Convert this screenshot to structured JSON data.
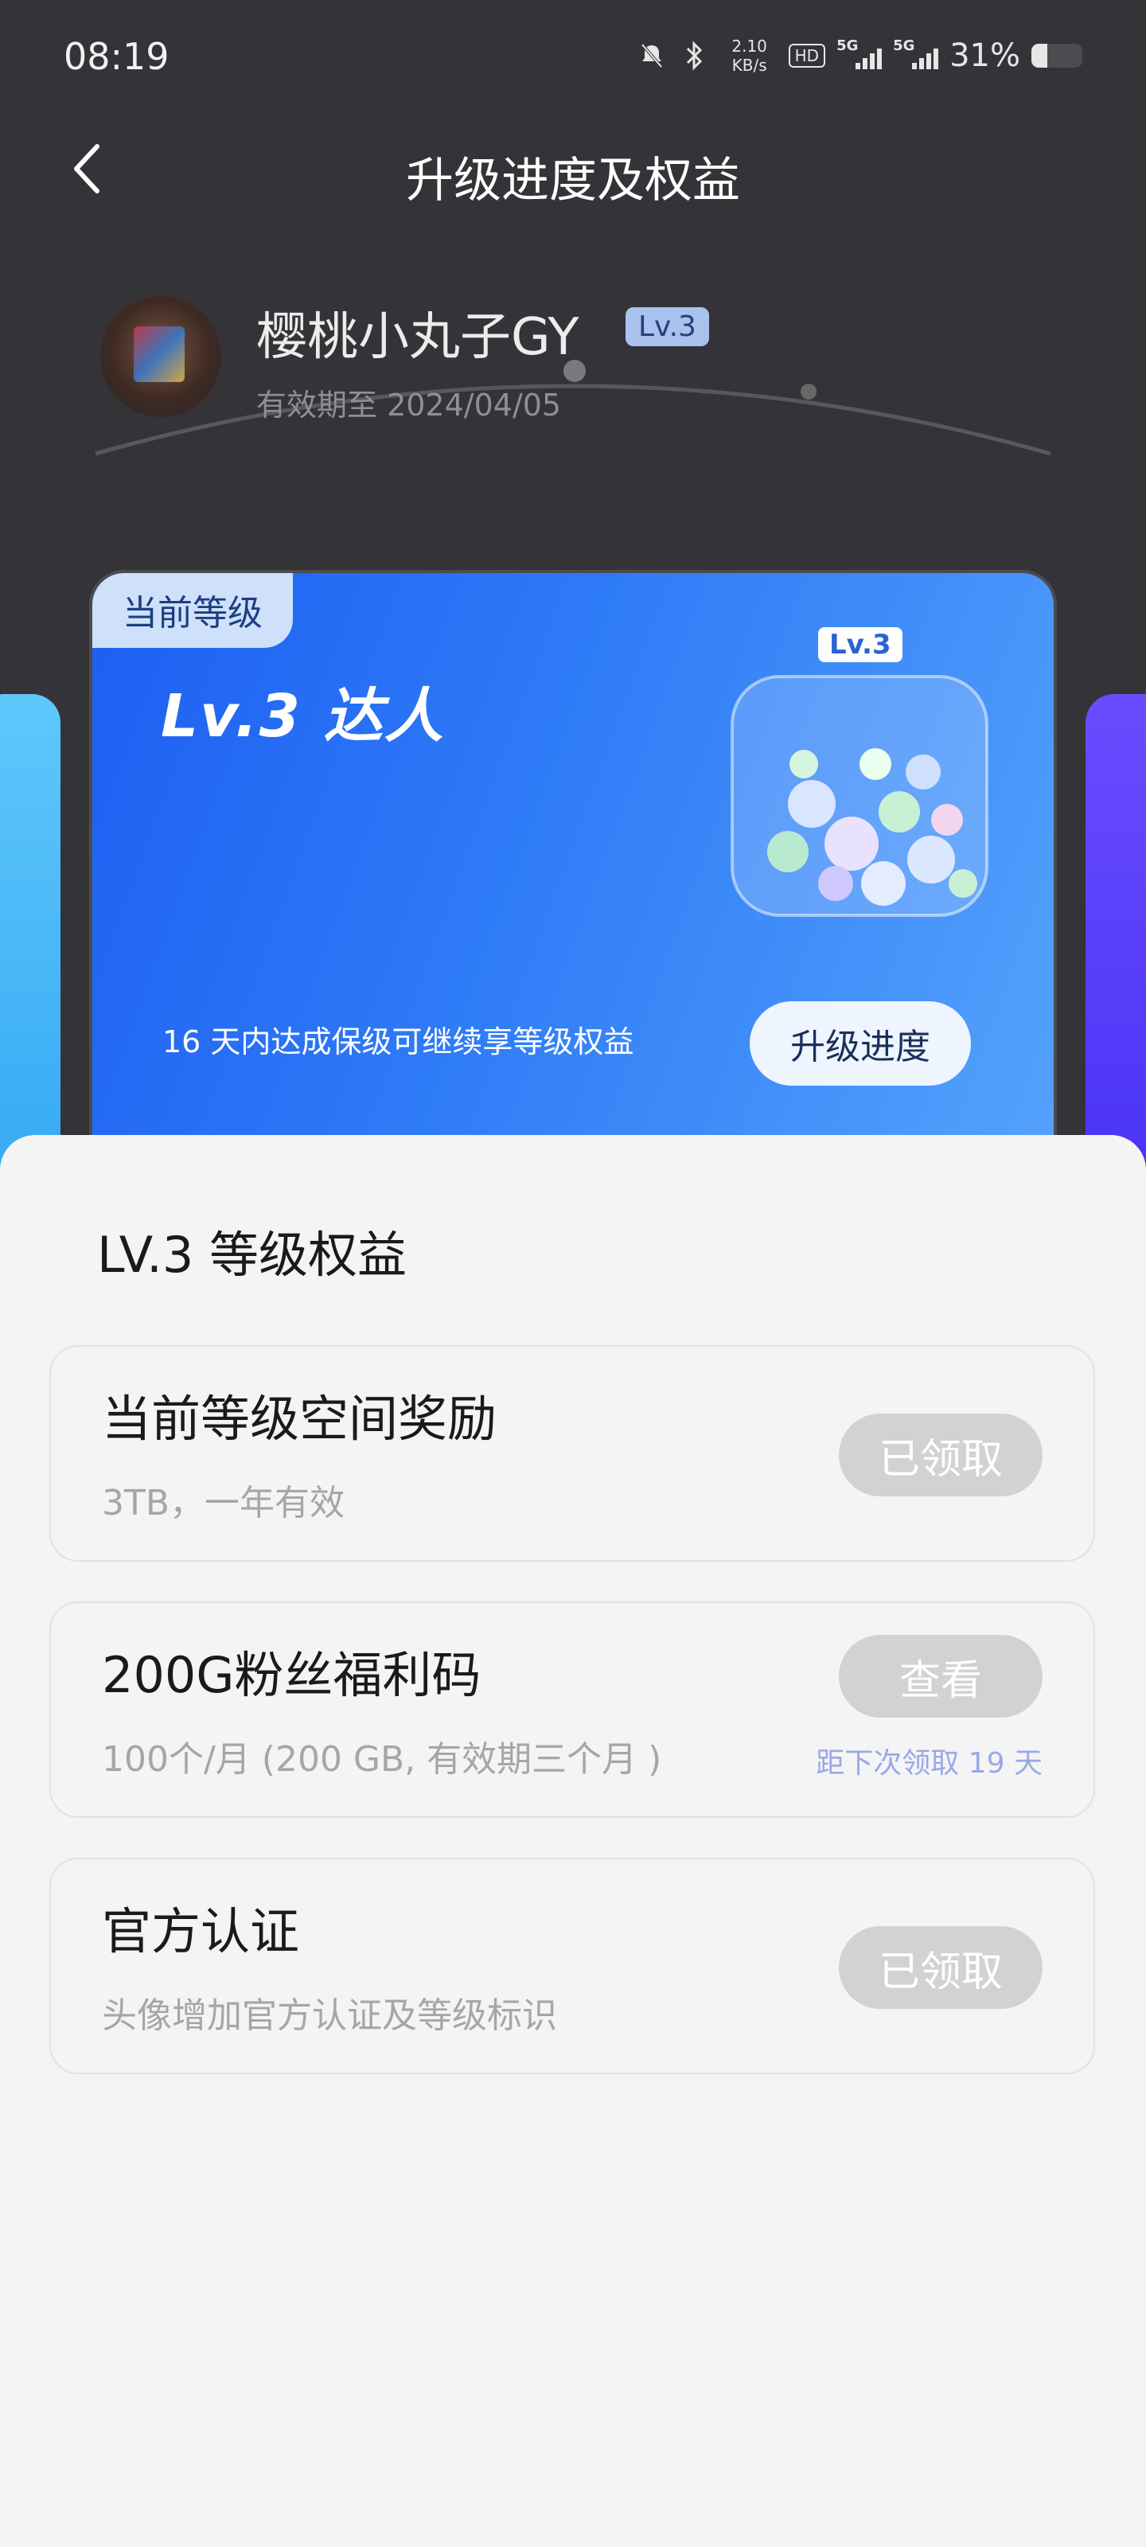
{
  "status_bar": {
    "time": "08:19",
    "net_speed_value": "2.10",
    "net_speed_unit": "KB/s",
    "hd_label": "HD",
    "signal1_label": "5G",
    "signal2_label": "5G",
    "battery_percent": "31%",
    "battery_level": 0.31,
    "icons": [
      "mute-icon",
      "bluetooth-icon",
      "hd-icon",
      "signal-icon",
      "signal-icon",
      "battery-icon"
    ]
  },
  "header": {
    "title": "升级进度及权益",
    "back_icon": "chevron-left-icon"
  },
  "user": {
    "name": "樱桃小丸子GY",
    "level_chip": "Lv.3",
    "validity": "有效期至 2024/04/05"
  },
  "level_card": {
    "tag": "当前等级",
    "title": "Lv.3 达人",
    "jar_label": "Lv.3",
    "hint": "16 天内达成保级可继续享等级权益",
    "progress_button": "升级进度",
    "colors": {
      "start": "#1e5ef2",
      "end": "#55a3fc"
    }
  },
  "benefits_section": {
    "title": "LV.3 等级权益",
    "items": [
      {
        "name": "当前等级空间奖励",
        "desc": "3TB，一年有效",
        "action": "已领取",
        "note": ""
      },
      {
        "name": "200G粉丝福利码",
        "desc": "100个/月 (200 GB, 有效期三个月 )",
        "action": "查看",
        "note": "距下次领取 19 天"
      },
      {
        "name": "官方认证",
        "desc": "头像增加官方认证及等级标识",
        "action": "已领取",
        "note": ""
      }
    ]
  }
}
